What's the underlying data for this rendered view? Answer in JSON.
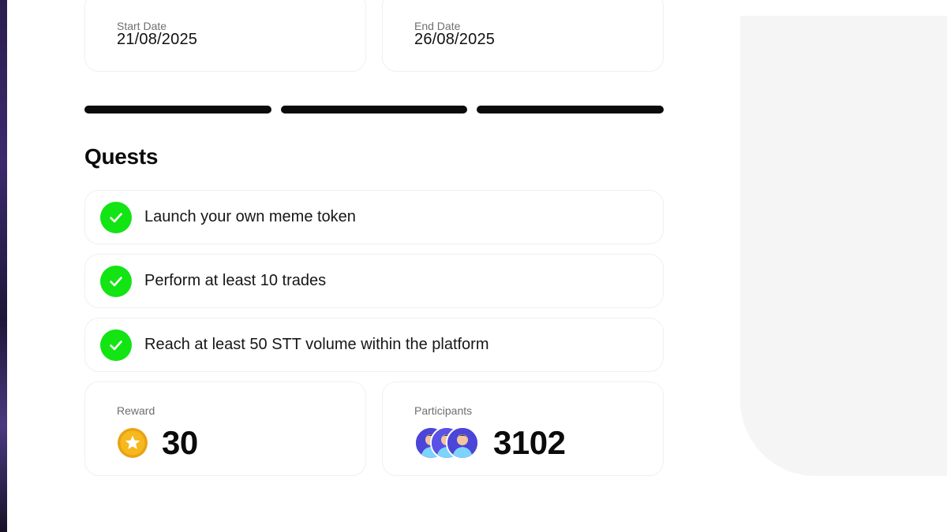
{
  "colors": {
    "check_green": "#13e413",
    "progress_dark": "#0b0b0b",
    "side_panel": "#f5f5f5",
    "coin_gold": "#f6b81c",
    "avatar_blue": "#4b45d8"
  },
  "dates": {
    "start": {
      "label": "Start Date",
      "value": "21/08/2025"
    },
    "end": {
      "label": "End Date",
      "value": "26/08/2025"
    }
  },
  "progress": {
    "segments_total": 3,
    "segments_filled": 3
  },
  "quests": {
    "title": "Quests",
    "items": [
      {
        "label": "Launch your own meme token",
        "completed": true,
        "icon": "check-circle-icon"
      },
      {
        "label": "Perform at least 10 trades",
        "completed": true,
        "icon": "check-circle-icon"
      },
      {
        "label": "Reach at least 50 STT volume within the platform",
        "completed": true,
        "icon": "check-circle-icon"
      }
    ]
  },
  "stats": {
    "reward": {
      "label": "Reward",
      "value": "30",
      "icon": "star-coin-icon"
    },
    "participants": {
      "label": "Participants",
      "value": "3102",
      "icon": "avatar-stack-icon"
    }
  }
}
